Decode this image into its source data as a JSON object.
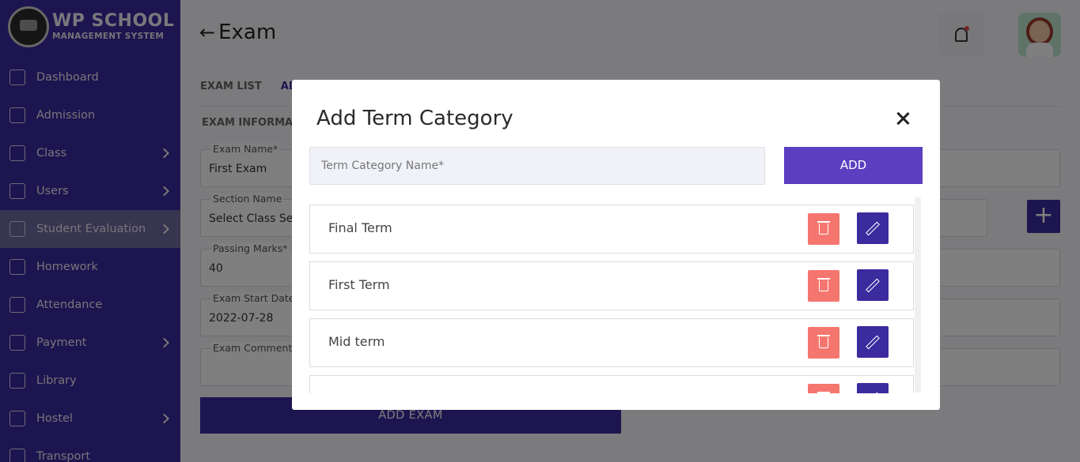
{
  "sidebar": {
    "logo_title": "WP SCHOOL",
    "logo_subtitle": "MANAGEMENT SYSTEM",
    "items": [
      {
        "label": "Dashboard",
        "icon": "dashboard-icon",
        "chevron": false
      },
      {
        "label": "Admission",
        "icon": "admission-icon",
        "chevron": false
      },
      {
        "label": "Class",
        "icon": "class-icon",
        "chevron": true
      },
      {
        "label": "Users",
        "icon": "users-icon",
        "chevron": true
      },
      {
        "label": "Student Evaluation",
        "icon": "evaluation-icon",
        "chevron": true,
        "active": true
      },
      {
        "label": "Homework",
        "icon": "homework-icon",
        "chevron": false
      },
      {
        "label": "Attendance",
        "icon": "attendance-icon",
        "chevron": false
      },
      {
        "label": "Payment",
        "icon": "wallet-icon",
        "chevron": true
      },
      {
        "label": "Library",
        "icon": "library-icon",
        "chevron": false
      },
      {
        "label": "Hostel",
        "icon": "hostel-icon",
        "chevron": true
      },
      {
        "label": "Transport",
        "icon": "bus-icon",
        "chevron": false
      }
    ]
  },
  "header": {
    "back_arrow": "←",
    "title": "Exam"
  },
  "tabs": {
    "exam_list": "EXAM LIST",
    "add_exam": "ADD"
  },
  "form": {
    "section_title": "EXAM INFORMAT",
    "exam_name_label": "Exam Name*",
    "exam_name_value": "First Exam",
    "section_name_label": "Section Name",
    "section_name_value": "Select Class Se",
    "passing_marks_label": "Passing Marks*",
    "passing_marks_value": "40",
    "start_date_label": "Exam Start Date",
    "start_date_value": "2022-07-28",
    "comment_label": "Exam Comment",
    "add_exam_button": "ADD EXAM",
    "plus_symbol": "+"
  },
  "modal": {
    "title": "Add Term Category",
    "input_placeholder": "Term Category Name*",
    "input_value": "",
    "add_button": "ADD",
    "terms": [
      "Final Term",
      "First Term",
      "Mid term",
      ""
    ]
  },
  "colors": {
    "primary": "#3b2b9e",
    "add_button": "#5b3fc0",
    "delete_button": "#f5766e"
  }
}
